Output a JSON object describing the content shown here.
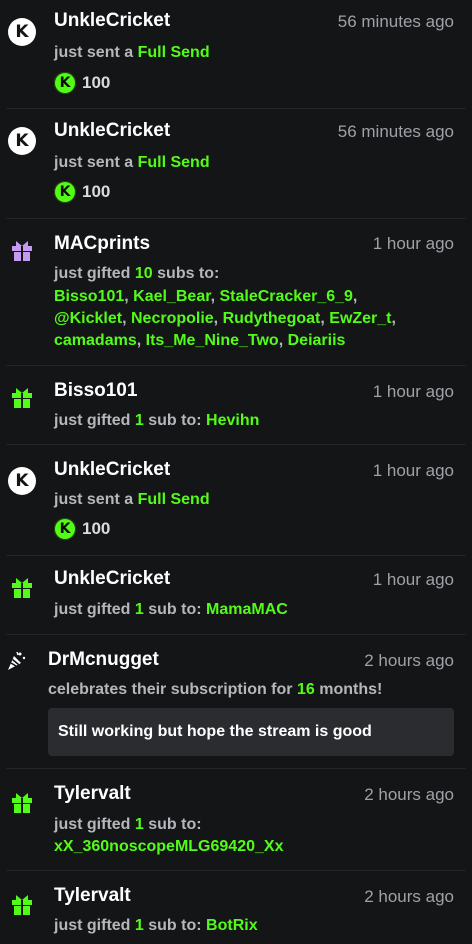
{
  "colors": {
    "background": "#141517",
    "accent": "#53fc18",
    "secondary_text": "#b4b7bb",
    "time_text": "#9ea1a6"
  },
  "events": [
    {
      "icon": "kick-k-icon",
      "username": "UnkleCricket",
      "time": "56 minutes ago",
      "action": "just sent a",
      "highlight": "Full Send",
      "coin_glyph": "K",
      "amount": "100"
    },
    {
      "icon": "kick-k-icon",
      "username": "UnkleCricket",
      "time": "56 minutes ago",
      "action": "just sent a",
      "highlight": "Full Send",
      "coin_glyph": "K",
      "amount": "100"
    },
    {
      "icon": "gift-purple-icon",
      "username": "MACprints",
      "time": "1 hour ago",
      "action_prefix": "just gifted",
      "count": "10",
      "action_suffix": "subs to:",
      "recipients": [
        "Bisso101",
        "Kael_Bear",
        "StaleCracker_6_9",
        "@Kicklet",
        "Necropolie",
        "Rudythegoat",
        "EwZer_t",
        "camadams",
        "Its_Me_Nine_Two",
        "Deiariis"
      ],
      "separator": ","
    },
    {
      "icon": "gift-green-icon",
      "username": "Bisso101",
      "time": "1 hour ago",
      "action_prefix": "just gifted",
      "count": "1",
      "action_suffix": "sub to:",
      "recipients": [
        "Hevihn"
      ]
    },
    {
      "icon": "kick-k-icon",
      "username": "UnkleCricket",
      "time": "1 hour ago",
      "action": "just sent a",
      "highlight": "Full Send",
      "coin_glyph": "K",
      "amount": "100"
    },
    {
      "icon": "gift-green-icon",
      "username": "UnkleCricket",
      "time": "1 hour ago",
      "action_prefix": "just gifted",
      "count": "1",
      "action_suffix": "sub to:",
      "recipients": [
        "MamaMAC"
      ]
    },
    {
      "icon": "party-popper-icon",
      "username": "DrMcnugget",
      "time": "2 hours ago",
      "action_prefix": "celebrates their subscription for",
      "count": "16",
      "action_suffix": "months!",
      "message": "Still working but hope the stream is good"
    },
    {
      "icon": "gift-green-icon",
      "username": "Tylervalt",
      "time": "2 hours ago",
      "action_prefix": "just gifted",
      "count": "1",
      "action_suffix": "sub to:",
      "recipients": [
        "xX_360noscopeMLG69420_Xx"
      ]
    },
    {
      "icon": "gift-green-icon",
      "username": "Tylervalt",
      "time": "2 hours ago",
      "action_prefix": "just gifted",
      "count": "1",
      "action_suffix": "sub to:",
      "recipients": [
        "BotRix"
      ]
    }
  ]
}
